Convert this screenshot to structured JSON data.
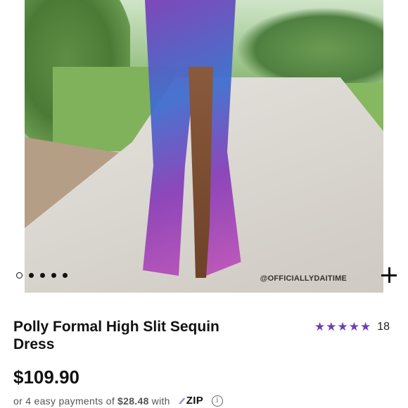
{
  "gallery": {
    "watermark": "@OFFICIALLYDAITIME",
    "dots": [
      {
        "active": true
      },
      {
        "active": false
      },
      {
        "active": false
      },
      {
        "active": false
      },
      {
        "active": false
      }
    ],
    "expand_icon": "plus-icon"
  },
  "product": {
    "title": "Polly Formal High Slit Sequin Dress",
    "rating_stars": "★★★★★",
    "review_count": "18",
    "price": "$109.90"
  },
  "payments": {
    "prefix": "or 4 easy payments of",
    "amount": "$28.48",
    "with": "with",
    "provider": "ZIP",
    "info_icon": "info-icon"
  },
  "colors": {
    "star": "#6b3fb3",
    "zip_accent": "#9b7be6"
  }
}
